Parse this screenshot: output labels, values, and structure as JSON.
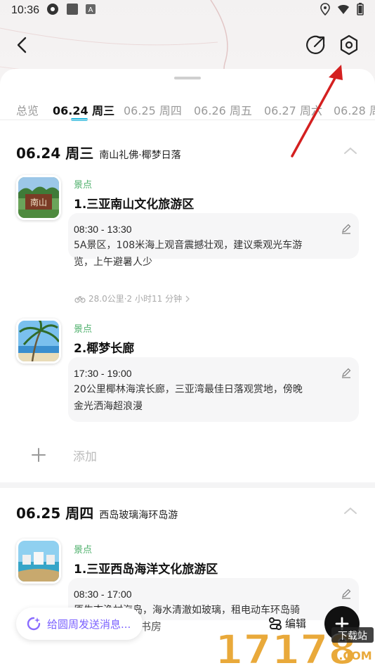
{
  "status_bar": {
    "time": "10:36"
  },
  "tabs": [
    "总览",
    "06.24 周三",
    "06.25 周四",
    "06.26 周五",
    "06.27 周六",
    "06.28 周"
  ],
  "days": [
    {
      "date": "06.24 周三",
      "subtitle": "南山礼佛·椰梦日落",
      "stops": [
        {
          "type": "景点",
          "title": "1.三亚南山文化旅游区",
          "time": "08:30 - 13:30",
          "desc_lines": [
            "5A景区，108米海上观音震撼壮观，建议乘观光车游",
            "览，上午避暑人少"
          ],
          "thumb_text": "南山"
        },
        {
          "type": "景点",
          "title": "2.椰梦长廊",
          "time": "17:30 - 19:00",
          "desc_lines": [
            "20公里椰林海滨长廊，三亚湾最佳日落观赏地，傍晚",
            "金光洒海超浪漫"
          ]
        }
      ],
      "transit": "28.0公里·2 小时11 分钟",
      "add_label": "添加"
    },
    {
      "date": "06.25 周四",
      "subtitle": "西岛玻璃海环岛游",
      "stops": [
        {
          "type": "景点",
          "title": "1.三亚西岛海洋文化旅游区",
          "time": "08:30 - 17:00",
          "desc_lines": [
            "原生态渔村海岛，海水清澈如玻璃，租电动车环岛骑"
          ]
        }
      ]
    }
  ],
  "bottom": {
    "chat_placeholder": "给圆周发送消息...",
    "behind_text": "书房",
    "edit_label": "编辑"
  },
  "watermark": {
    "number": "17178",
    "sub1": "下载站",
    "sub2": ".COM"
  },
  "colors": {
    "accent": "#1fb8e0",
    "stop_type": "#4caf6a",
    "chat": "#7b61ff",
    "arrow": "#d42020"
  }
}
